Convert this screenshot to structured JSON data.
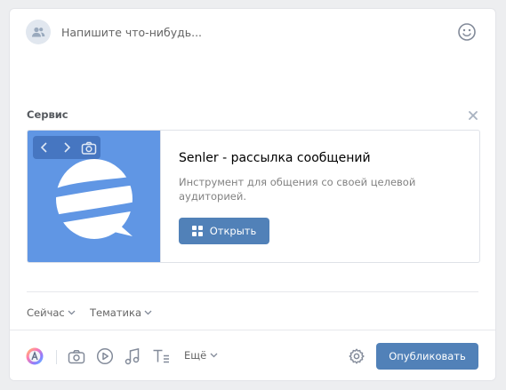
{
  "composer": {
    "placeholder": "Напишите что-нибудь...",
    "avatar_icon": "users-icon",
    "emoji_icon": "smile-icon"
  },
  "attachment": {
    "section_title": "Сервис",
    "close_icon": "close-icon",
    "thumbnail_controls": [
      "chevron-left-icon",
      "chevron-right-icon",
      "camera-icon"
    ],
    "logo": "senler-logo",
    "title": "Senler - рассылка сообщений",
    "description": "Инструмент для общения со своей целевой аудиторией.",
    "open_label": "Открыть",
    "open_icon": "apps-grid-icon"
  },
  "meta": {
    "time_label": "Сейчас",
    "topic_label": "Тематика"
  },
  "toolbar": {
    "icons": [
      "color-circle-icon",
      "camera-icon",
      "video-play-icon",
      "music-note-icon",
      "text-format-icon"
    ],
    "more_label": "Ещё",
    "settings_icon": "gear-icon",
    "publish_label": "Опубликовать"
  },
  "colors": {
    "accent": "#5181b8",
    "thumb_bg": "#6096e4",
    "page_bg": "#edeef0",
    "muted_text": "#656565"
  }
}
